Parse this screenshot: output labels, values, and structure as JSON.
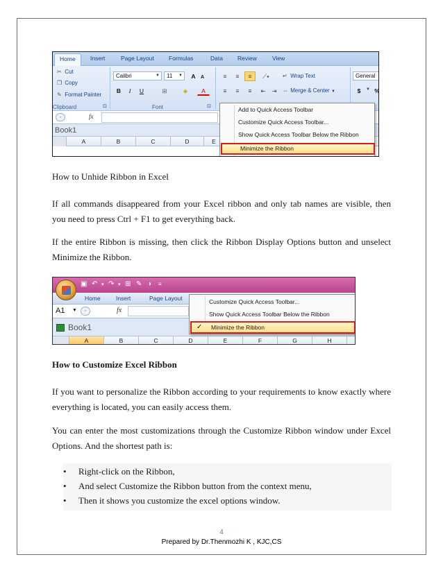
{
  "screenshot1": {
    "tabs": [
      "Home",
      "Insert",
      "Page Layout",
      "Formulas",
      "Data",
      "Review",
      "View"
    ],
    "clipboard": {
      "cut": "Cut",
      "copy": "Copy",
      "format_painter": "Format Painter",
      "label": "Clipboard"
    },
    "font": {
      "name": "Calibri",
      "size": "11",
      "label": "Font",
      "bold": "B",
      "italic": "I",
      "underline": "U",
      "grow": "A",
      "shrink": "A"
    },
    "alignment": {
      "wrap_text": "Wrap Text",
      "merge_center": "Merge & Center"
    },
    "number": {
      "format": "General",
      "currency": "$",
      "percent": "%"
    },
    "formula_bar": {
      "fx": "fx"
    },
    "workbook_title": "Book1",
    "columns": [
      "A",
      "B",
      "C",
      "D",
      "E"
    ],
    "context_menu": [
      "Add to Quick Access Toolbar",
      "Customize Quick Access Toolbar...",
      "Show Quick Access Toolbar Below the Ribbon",
      "Minimize the Ribbon"
    ],
    "highlight_color": "#d41e1e"
  },
  "text": {
    "unhide_title": "How to Unhide Ribbon in Excel",
    "para1": "If all commands disappeared from your Excel ribbon and only tab names are visible, then you need to press Ctrl + F1 to get everything back.",
    "para2": "If the entire Ribbon is missing, then click the Ribbon Display Options button and unselect Minimize the Ribbon.",
    "customize_heading": "How to Customize Excel Ribbon",
    "para3": "If you want to personalize the Ribbon according to your requirements to know exactly where everything is located, you can easily access them.",
    "para4": "You can enter the most customizations through the Customize Ribbon window under Excel Options. And the shortest path is:",
    "bullets": [
      "Right-click on the Ribbon,",
      "And select Customize the Ribbon button from the context menu,",
      "Then it shows you customize the excel options window."
    ]
  },
  "screenshot2": {
    "tabs": [
      "Home",
      "Insert",
      "Page Layout"
    ],
    "name_box": "A1",
    "fx": "fx",
    "workbook_title": "Book1",
    "columns": [
      "A",
      "B",
      "C",
      "D",
      "E",
      "F",
      "G",
      "H"
    ],
    "context_menu": [
      "Customize Quick Access Toolbar...",
      "Show Quick Access Toolbar Below the Ribbon",
      "Minimize the Ribbon"
    ],
    "checkmark": "✓",
    "qat_color": "#c9549f"
  },
  "footer": {
    "page_number": "4",
    "prepared_by": "Prepared by  Dr.Thenmozhi K , KJC,CS"
  }
}
